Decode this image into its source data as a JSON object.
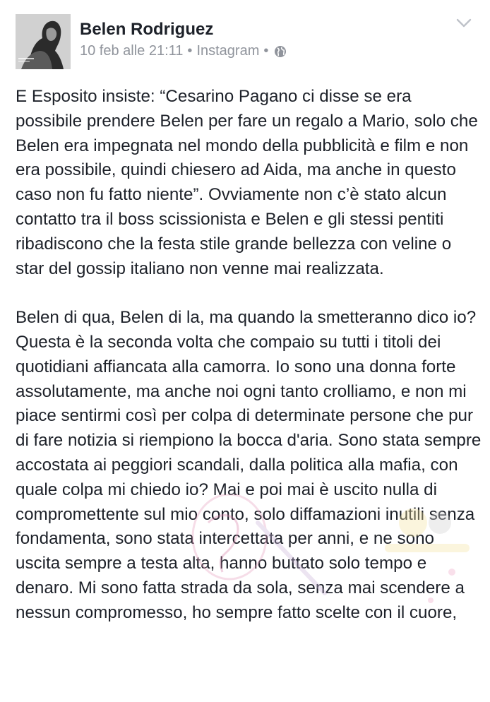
{
  "post": {
    "author": "Belen Rodriguez",
    "timestamp": "10 feb alle 21:11",
    "separator": "•",
    "source": "Instagram",
    "privacy_icon": "globe-icon",
    "menu_icon": "chevron-down-icon",
    "paragraphs": [
      "E Esposito insiste: “Cesarino Pagano ci disse se era possibile prendere Belen per fare un regalo a Mario, solo che Belen era impegnata nel mondo della pubblicità e film e non era possibile, quindi chiesero ad Aida, ma anche in questo caso non fu fatto niente”. Ovviamente non c’è stato alcun contatto tra il boss scissionista e Belen e gli stessi pentiti ribadiscono che la festa stile grande bellezza con veline o star del gossip italiano non venne mai realizzata.",
      "Belen di qua, Belen di la, ma quando la smetteranno dico io? Questa è la seconda volta che compaio su tutti i titoli dei quotidiani affiancata alla camorra. Io sono una donna forte assolutamente, ma anche noi ogni tanto crolliamo, e non mi piace sentirmi così per colpa di determinate persone che pur di fare notizia si riempiono la bocca d'aria. Sono stata sempre accostata ai peggiori scandali, dalla politica alla mafia, con quale colpa mi chiedo io? Mai e poi mai è uscito nulla di compromettente sul mio conto, solo diffamazioni inutili senza fondamenta, sono stata intercettata per anni, e ne sono uscita sempre a testa alta, hanno buttato solo tempo e denaro. Mi sono fatta strada da sola, senza mai scendere a nessun compromesso, ho sempre fatto scelte con il cuore,"
    ]
  },
  "colors": {
    "text": "#1d2129",
    "meta": "#90949c",
    "background": "#ffffff"
  }
}
